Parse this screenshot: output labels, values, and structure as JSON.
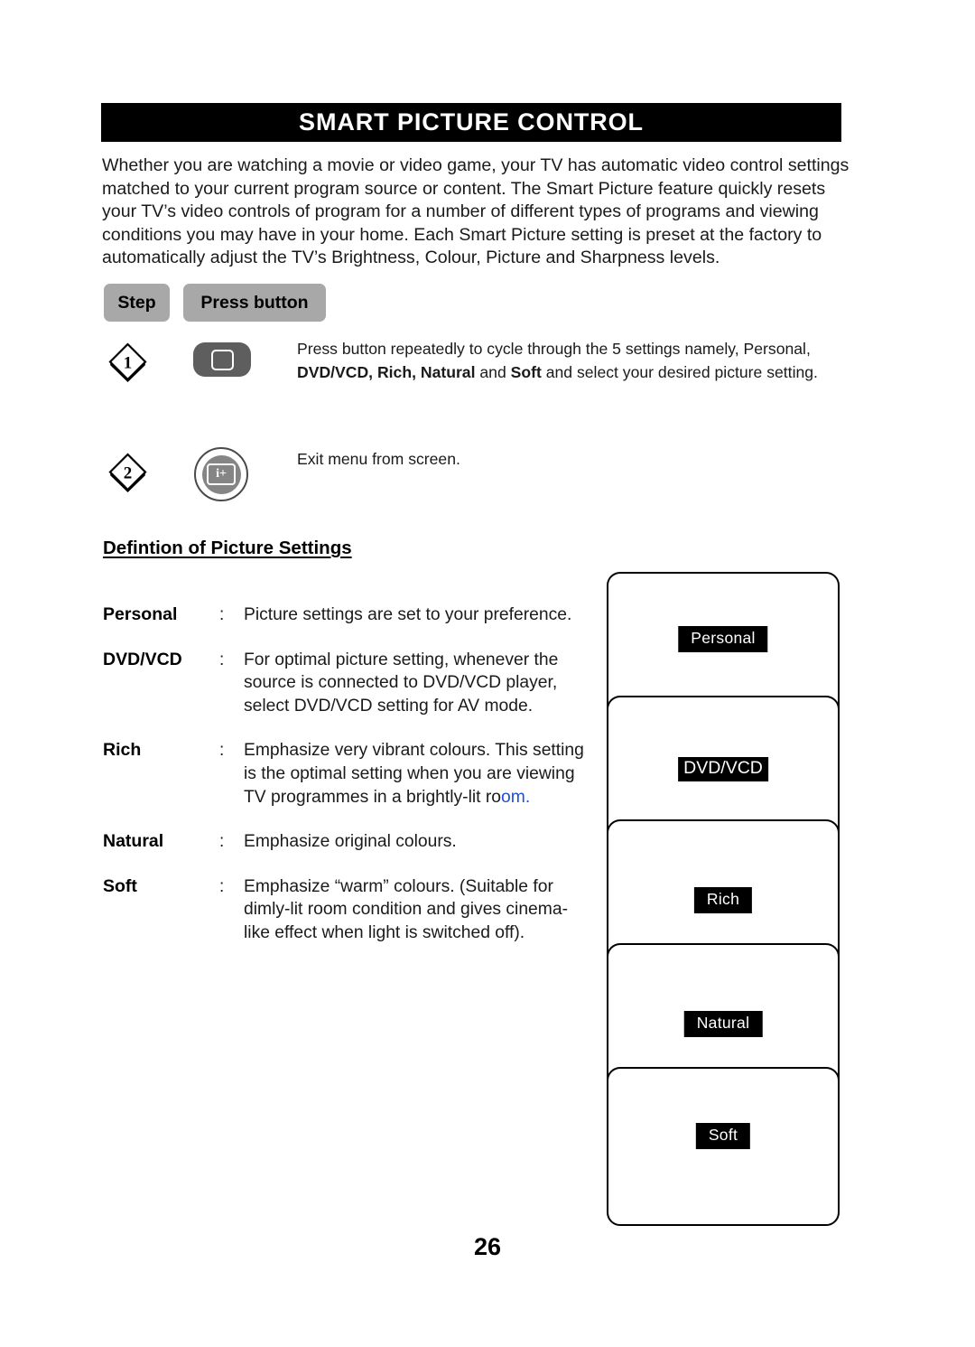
{
  "header": {
    "title": "SMART PICTURE CONTROL"
  },
  "intro": {
    "paragraph": "Whether you are watching a movie or video game, your TV has automatic video control settings matched to your current program source or content. The Smart Picture feature quickly resets your TV’s video controls of program for a number of different types of programs and viewing conditions you may have in your home. Each Smart Picture setting is preset at the factory to automatically adjust the TV’s Brightness, Colour, Picture and Sharpness levels."
  },
  "table_header": {
    "step_label": "Step",
    "press_button_label": "Press button"
  },
  "steps": [
    {
      "number": "1",
      "icon": "tv-screen-button-icon",
      "text_part1": "Press button repeatedly to cycle through the 5 settings namely, Personal, ",
      "text_bold1": "DVD/VCD, Rich, Natural",
      "text_part2": " and ",
      "text_bold2": "Soft",
      "text_part3": " and select your desired picture setting."
    },
    {
      "number": "2",
      "icon": "info-plus-button-icon",
      "text_part1": "Exit menu from screen.",
      "text_bold1": "",
      "text_part2": "",
      "text_bold2": "",
      "text_part3": ""
    }
  ],
  "definitions": {
    "heading": "Defintion of Picture Settings",
    "colon": ":",
    "items": [
      {
        "term": "Personal",
        "description": "Picture settings are set to your preference.",
        "description_tail": "",
        "tail_color": ""
      },
      {
        "term": "DVD/VCD",
        "description": "For optimal picture setting, whenever the source is connected to DVD/VCD player, select DVD/VCD setting for AV mode.",
        "description_tail": "",
        "tail_color": ""
      },
      {
        "term": "Rich",
        "description": "Emphasize very vibrant colours. This setting is the optimal setting when you are viewing TV programmes in a brightly-lit ro",
        "description_tail": "om.",
        "tail_color": "#1a4fe0"
      },
      {
        "term": "Natural",
        "description": "Emphasize original colours.",
        "description_tail": "",
        "tail_color": ""
      },
      {
        "term": "Soft",
        "description": "Emphasize “warm” colours. (Suitable for dimly-lit room condition and gives cinema-like effect when light is switched off).",
        "description_tail": "",
        "tail_color": ""
      }
    ]
  },
  "screen_stack": {
    "screens": [
      {
        "label": "Personal",
        "style": "normal"
      },
      {
        "label": "DVD/VCD",
        "style": "wide"
      },
      {
        "label": "Rich",
        "style": "normal"
      },
      {
        "label": "Natural",
        "style": "normal"
      },
      {
        "label": "Soft",
        "style": "normal"
      }
    ]
  },
  "footer": {
    "page_number": "26"
  }
}
